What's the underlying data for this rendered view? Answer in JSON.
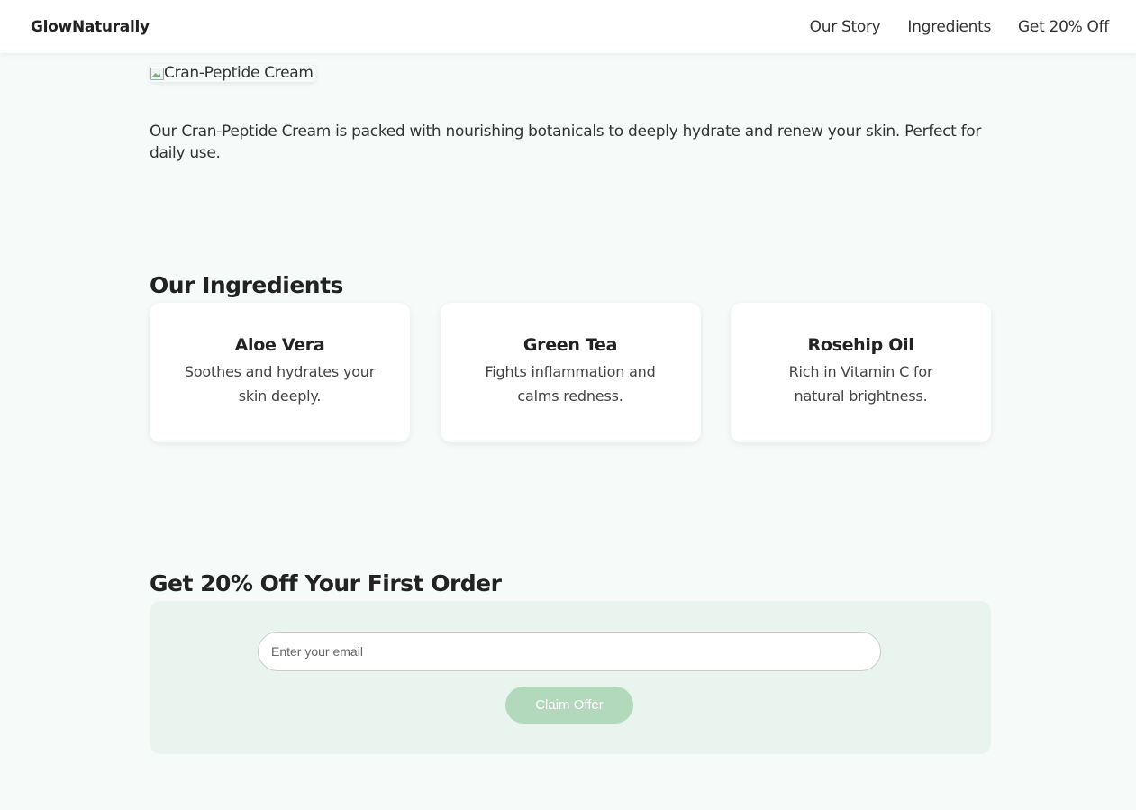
{
  "navbar": {
    "brand": "GlowNaturally",
    "links": [
      "Our Story",
      "Ingredients",
      "Get 20% Off"
    ]
  },
  "product": {
    "image_alt": "Cran-Peptide Cream",
    "description": "Our Cran-Peptide Cream is packed with nourishing botanicals to deeply hydrate and renew your skin. Perfect for daily use."
  },
  "ingredients": {
    "title": "Our Ingredients",
    "cards": [
      {
        "name": "Aloe Vera",
        "text": "Soothes and hydrates your skin deeply."
      },
      {
        "name": "Green Tea",
        "text": "Fights inflammation and calms redness."
      },
      {
        "name": "Rosehip Oil",
        "text": "Rich in Vitamin C for natural brightness."
      }
    ]
  },
  "offer": {
    "title": "Get 20% Off Your First Order",
    "email_placeholder": "Enter your email",
    "button_label": "Claim Offer"
  },
  "colors": {
    "page_background": "#f6faf8",
    "offer_background": "#eaf4ee",
    "button_background": "#b2d9bb"
  }
}
